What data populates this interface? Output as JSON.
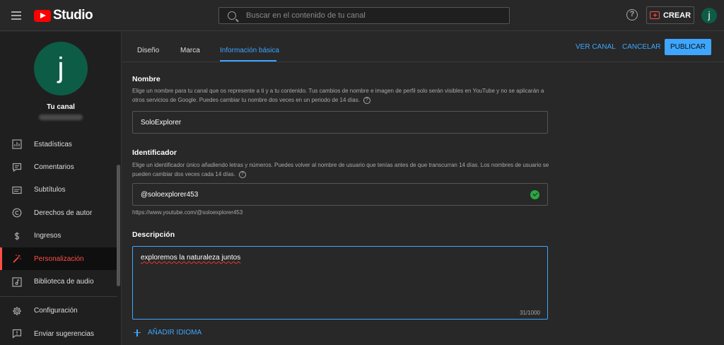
{
  "topbar": {
    "logo_text": "Studio",
    "search_placeholder": "Buscar en el contenido de tu canal",
    "help_symbol": "?",
    "create_label": "CREAR",
    "avatar_letter": "j"
  },
  "sidebar": {
    "avatar_letter": "j",
    "channel_label": "Tu canal",
    "items": [
      {
        "label": "Estadísticas",
        "icon": "chart-icon"
      },
      {
        "label": "Comentarios",
        "icon": "comment-icon"
      },
      {
        "label": "Subtítulos",
        "icon": "subtitles-icon"
      },
      {
        "label": "Derechos de autor",
        "icon": "copyright-icon"
      },
      {
        "label": "Ingresos",
        "icon": "dollar-icon"
      },
      {
        "label": "Personalización",
        "icon": "magic-wand-icon",
        "active": true
      },
      {
        "label": "Biblioteca de audio",
        "icon": "audio-library-icon"
      },
      {
        "label": "Configuración",
        "icon": "gear-icon"
      },
      {
        "label": "Enviar sugerencias",
        "icon": "feedback-icon"
      }
    ]
  },
  "tabs": [
    {
      "label": "Diseño"
    },
    {
      "label": "Marca"
    },
    {
      "label": "Información básica",
      "active": true
    }
  ],
  "header_actions": {
    "view_channel": "VER CANAL",
    "cancel": "CANCELAR",
    "publish": "PUBLICAR"
  },
  "name_section": {
    "title": "Nombre",
    "description": "Elige un nombre para tu canal que os represente a ti y a tu contenido. Tus cambios de nombre e imagen de perfil solo serán visibles en YouTube y no se aplicarán a otros servicios de Google. Puedes cambiar tu nombre dos veces en un periodo de 14 días.",
    "value": "SoloExplorer"
  },
  "handle_section": {
    "title": "Identificador",
    "description": "Elige un identificador único añadiendo letras y números. Puedes volver al nombre de usuario que tenías antes de que transcurran 14 días. Los nombres de usuario se pueden cambiar dos veces cada 14 días.",
    "value": "@soloexplorer453",
    "url": "https://www.youtube.com/@soloexplorer453"
  },
  "description_section": {
    "title": "Descripción",
    "value": "exploremos la naturaleza juntos",
    "counter": "31/1000"
  },
  "add_language": "AÑADIR IDIOMA",
  "colors": {
    "accent": "#3ea6ff",
    "active_nav": "#ff4e45",
    "avatar": "#0d5c46",
    "success": "#2ba640"
  }
}
